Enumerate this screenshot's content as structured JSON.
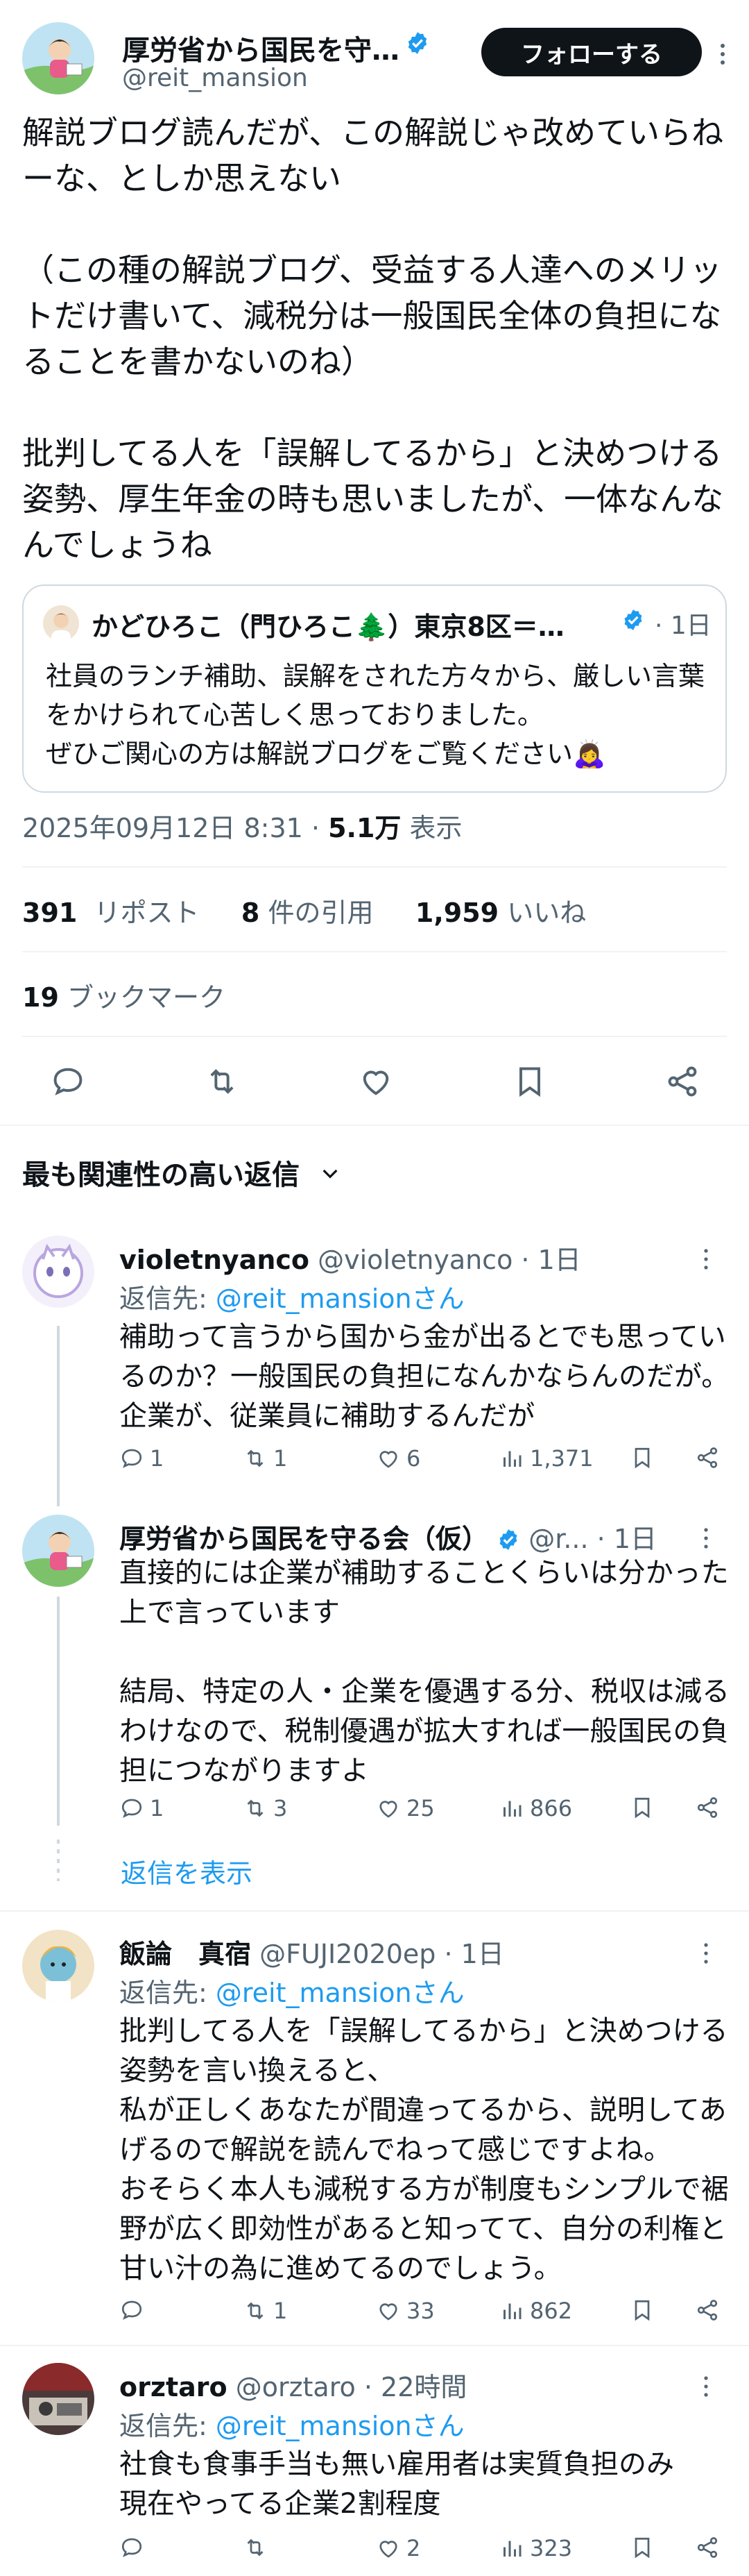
{
  "author": {
    "name": "厚労省から国民を守…",
    "handle": "@reit_mansion",
    "follow_label": "フォローする"
  },
  "tweet": {
    "text": "解説ブログ読んだが、この解説じゃ改めていらねーな、としか思えない\n\n（この種の解説ブログ、受益する人達へのメリットだけ書いて、減税分は一般国民全体の負担になることを書かないのね）\n\n批判してる人を「誤解してるから」と決めつける姿勢、厚生年金の時も思いましたが、一体なんなんでしょうね",
    "timestamp": "2025年09月12日 8:31",
    "views_count": "5.1万",
    "views_label": "表示",
    "retweets_count": "391",
    "retweets_label": "リポスト",
    "quotes_count": "8",
    "quotes_label": "件の引用",
    "likes_count": "1,959",
    "likes_label": "いいね",
    "bookmarks_count": "19",
    "bookmarks_label": "ブックマーク"
  },
  "quote": {
    "name": "かどひろこ（門ひろこ🌲）東京8区＝…",
    "time": "· 1日",
    "text": "社員のランチ補助、誤解をされた方々から、厳しい言葉をかけられて心苦しく思っておりました。\nぜひご関心の方は解説ブログをご覧ください🙇‍♀️"
  },
  "section_title": "最も関連性の高い返信",
  "show_replies_label": "返信を表示",
  "reply_to_prefix": "返信先: ",
  "replies": [
    {
      "name": "violetnyanco",
      "handle": "@violetnyanco",
      "time": "· 1日",
      "reply_to": "@reit_mansionさん",
      "text": "補助って言うから国から金が出るとでも思っているのか？一般国民の負担になんかならんのだが。企業が、従業員に補助するんだが",
      "replies": "1",
      "retweets": "1",
      "likes": "6",
      "views": "1,371"
    },
    {
      "name": "厚労省から国民を守る会（仮）",
      "handle": "@r...",
      "time": "· 1日",
      "text": "直接的には企業が補助することくらいは分かった上で言っています\n\n結局、特定の人・企業を優遇する分、税収は減るわけなので、税制優遇が拡大すれば一般国民の負担につながりますよ",
      "replies": "1",
      "retweets": "3",
      "likes": "25",
      "views": "866"
    },
    {
      "name": "飯論　真宿",
      "handle": "@FUJI2020ep",
      "time": "· 1日",
      "reply_to": "@reit_mansionさん",
      "text": "批判してる人を「誤解してるから」と決めつける姿勢を言い換えると、\n私が正しくあなたが間違ってるから、説明してあげるので解説を読んでねって感じですよね。\nおそらく本人も減税する方が制度もシンプルで裾野が広く即効性があると知ってて、自分の利権と甘い汁の為に進めてるのでしょう。",
      "replies": "",
      "retweets": "1",
      "likes": "33",
      "views": "862"
    },
    {
      "name": "orztaro",
      "handle": "@orztaro",
      "time": "· 22時間",
      "reply_to": "@reit_mansionさん",
      "text": "社食も食事手当も無い雇用者は実質負担のみ\n現在やってる企業2割程度",
      "replies": "",
      "retweets": "",
      "likes": "2",
      "views": "323"
    }
  ],
  "colors": {
    "text": "#0f1419",
    "muted": "#536471",
    "accent": "#1d9bf0",
    "verified": "#1d9bf0",
    "border": "#cfd9de"
  },
  "icons": [
    "verified-badge-icon",
    "more-icon",
    "reply-icon",
    "retweet-icon",
    "like-icon",
    "bookmark-icon",
    "share-icon",
    "views-icon",
    "chevron-down-icon"
  ]
}
